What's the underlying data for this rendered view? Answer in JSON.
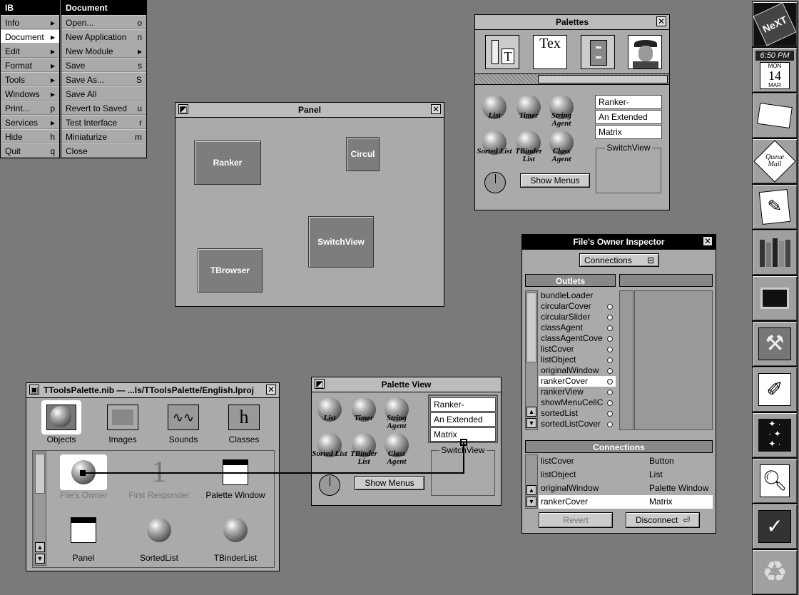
{
  "menus": {
    "ib": {
      "title": "IB",
      "items": [
        {
          "label": "Info",
          "key": "▸"
        },
        {
          "label": "Document",
          "key": "▸",
          "selected": true
        },
        {
          "label": "Edit",
          "key": "▸"
        },
        {
          "label": "Format",
          "key": "▸"
        },
        {
          "label": "Tools",
          "key": "▸"
        },
        {
          "label": "Windows",
          "key": "▸"
        },
        {
          "label": "Print...",
          "key": "p"
        },
        {
          "label": "Services",
          "key": "▸"
        },
        {
          "label": "Hide",
          "key": "h"
        },
        {
          "label": "Quit",
          "key": "q"
        }
      ]
    },
    "document": {
      "title": "Document",
      "items": [
        {
          "label": "Open...",
          "key": "o"
        },
        {
          "label": "New Application",
          "key": "n"
        },
        {
          "label": "New Module",
          "key": "▸"
        },
        {
          "label": "Save",
          "key": "s"
        },
        {
          "label": "Save As...",
          "key": "S"
        },
        {
          "label": "Save All",
          "key": ""
        },
        {
          "label": "Revert to Saved",
          "key": "u"
        },
        {
          "label": "Test Interface",
          "key": "r"
        },
        {
          "label": "Miniaturize",
          "key": "m"
        },
        {
          "label": "Close",
          "key": ""
        }
      ]
    }
  },
  "panel": {
    "title": "Panel",
    "boxes": [
      "Ranker",
      "Circul",
      "SwitchView",
      "TBrowser"
    ]
  },
  "palettes": {
    "title": "Palettes",
    "tab_icons": [
      "views-icon",
      "text-icon",
      "file-cabinet-icon",
      "portrait-icon"
    ],
    "text_icon_label": "Tex",
    "agents": [
      "List",
      "Timer",
      "String Agent",
      "Sorted List",
      "TBinder List",
      "Class Agent"
    ],
    "fields": [
      "Ranker-",
      "An Extended",
      "Matrix"
    ],
    "switchview_label": "SwitchView",
    "show_menus": "Show Menus"
  },
  "palette_view": {
    "title": "Palette View",
    "agents": [
      "List",
      "Timer",
      "String Agent",
      "Sorted List",
      "TBinder List",
      "Class Agent"
    ],
    "fields": [
      "Ranker-",
      "An Extended",
      "Matrix"
    ],
    "switchview_label": "SwitchView",
    "show_menus": "Show Menus"
  },
  "inspector": {
    "title": "File's Owner Inspector",
    "popup": "Connections",
    "outlets_header": "Outlets",
    "outlets": [
      "bundleLoader",
      "circularCover",
      "circularSlider",
      "classAgent",
      "classAgentCove",
      "listCover",
      "listObject",
      "originalWindow",
      "rankerCover",
      "rankerView",
      "showMenuCellC",
      "sortedList",
      "sortedListCover"
    ],
    "selected_outlet": "rankerCover",
    "connections_header": "Connections",
    "connections": [
      {
        "outlet": "listCover",
        "class": "Button"
      },
      {
        "outlet": "listObject",
        "class": "List"
      },
      {
        "outlet": "originalWindow",
        "class": "Palette Window"
      },
      {
        "outlet": "rankerCover",
        "class": "Matrix",
        "selected": true
      }
    ],
    "revert": "Revert",
    "disconnect": "Disconnect"
  },
  "nib": {
    "title": "TToolsPalette.nib  —  ...ls/TToolsPalette/English.lproj",
    "tabs": [
      "Objects",
      "Images",
      "Sounds",
      "Classes"
    ],
    "classes_glyph": "h",
    "first_responder_glyph": "1",
    "objects": [
      "File's Owner",
      "First Responder",
      "Palette Window",
      "Panel",
      "SortedList",
      "TBinderList"
    ]
  },
  "dock": {
    "icons": [
      "next-logo-icon",
      "clock-calendar-icon",
      "mail-envelope-icon",
      "queue-mail-icon",
      "editor-icon",
      "library-books-icon",
      "terminal-icon",
      "preferences-tools-icon",
      "starfield-icon",
      "magnifier-document-icon",
      "interface-builder-icon",
      "recycler-icon"
    ],
    "logo_text": "NeXT",
    "clock_time": "6:50 PM",
    "clock_day": "MON",
    "clock_date": "14",
    "clock_month": "MAR",
    "queue_mail_text": "Queue Mail"
  }
}
